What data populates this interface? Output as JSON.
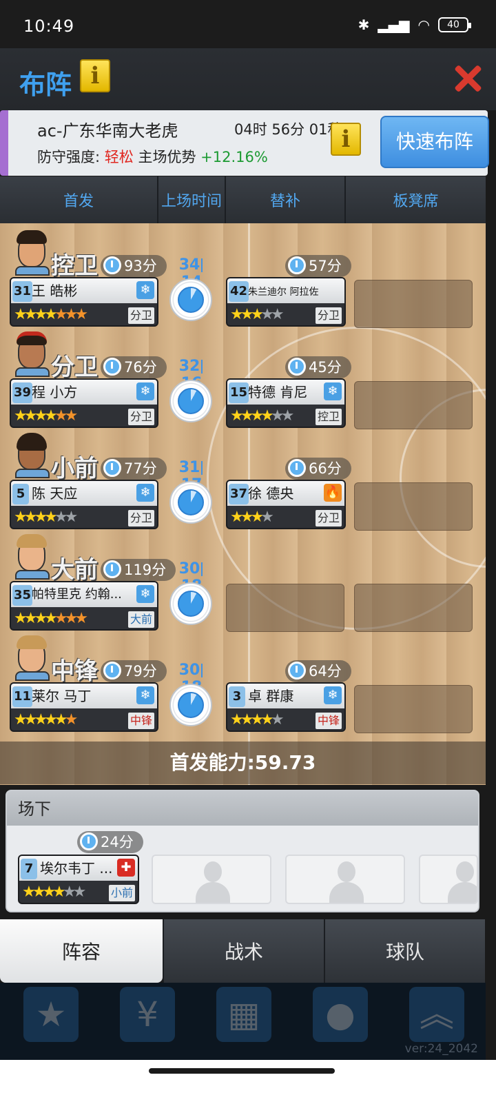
{
  "status_bar": {
    "time": "10:49",
    "battery": "40"
  },
  "header": {
    "title": "布阵",
    "info_icon": "i"
  },
  "opponent": {
    "name": "ac-广东华南大老虎",
    "timer": "04时 56分 01秒",
    "defense_label": "防守强度:",
    "defense_value": "轻松",
    "home_adv_label": "主场优势",
    "home_adv_value": "+12.16%",
    "quick_button": "快速布阵"
  },
  "columns": [
    "首发",
    "上场时间",
    "替补",
    "板凳席"
  ],
  "rows": [
    {
      "position": "控卫",
      "starter_minutes": "93分",
      "split_a": "34",
      "split_b": "14",
      "sub_minutes": "57分",
      "starter": {
        "number": "31",
        "name": "王 皓彬",
        "badge": "❄",
        "role": "分卫",
        "stars": "★★★★★★★"
      },
      "sub": {
        "number": "42",
        "name": "朱兰迪尔 阿拉佐",
        "badge": "",
        "role": "分卫",
        "stars": "★★★★★"
      }
    },
    {
      "position": "分卫",
      "starter_minutes": "76分",
      "split_a": "32",
      "split_b": "16",
      "sub_minutes": "45分",
      "starter": {
        "number": "39",
        "name": "程 小方",
        "badge": "❄",
        "role": "分卫",
        "stars": "★★★★★★"
      },
      "sub": {
        "number": "15",
        "name": "特德 肯尼",
        "badge": "❄",
        "role": "控卫",
        "stars": "★★★★★★"
      }
    },
    {
      "position": "小前",
      "starter_minutes": "77分",
      "split_a": "31",
      "split_b": "17",
      "sub_minutes": "66分",
      "starter": {
        "number": "5",
        "name": "陈 天应",
        "badge": "❄",
        "role": "分卫",
        "stars": "★★★★★★"
      },
      "sub": {
        "number": "37",
        "name": "徐 德央",
        "badge": "🔥",
        "role": "分卫",
        "stars": "★★★★"
      }
    },
    {
      "position": "大前",
      "starter_minutes": "119分",
      "split_a": "30",
      "split_b": "18",
      "sub_minutes": "",
      "starter": {
        "number": "35",
        "name": "帕特里克 约翰...",
        "badge": "❄",
        "role": "大前",
        "stars": "★★★★★★★"
      },
      "sub": null
    },
    {
      "position": "中锋",
      "starter_minutes": "79分",
      "split_a": "30",
      "split_b": "18",
      "sub_minutes": "64分",
      "starter": {
        "number": "11",
        "name": "莱尔 马丁",
        "badge": "❄",
        "role": "中锋",
        "stars": "★★★★★★"
      },
      "sub": {
        "number": "3",
        "name": "卓 群康",
        "badge": "❄",
        "role": "中锋",
        "stars": "★★★★★"
      }
    }
  ],
  "ability": "首发能力:59.73",
  "bench": {
    "title": "场下",
    "player": {
      "minutes": "24分",
      "number": "7",
      "name": "埃尔韦丁 ...",
      "badge": "✚",
      "role": "小前",
      "stars": "★★★★★"
    }
  },
  "bottom_tabs": [
    "阵容",
    "战术",
    "球队"
  ],
  "version": "ver:24_2042"
}
